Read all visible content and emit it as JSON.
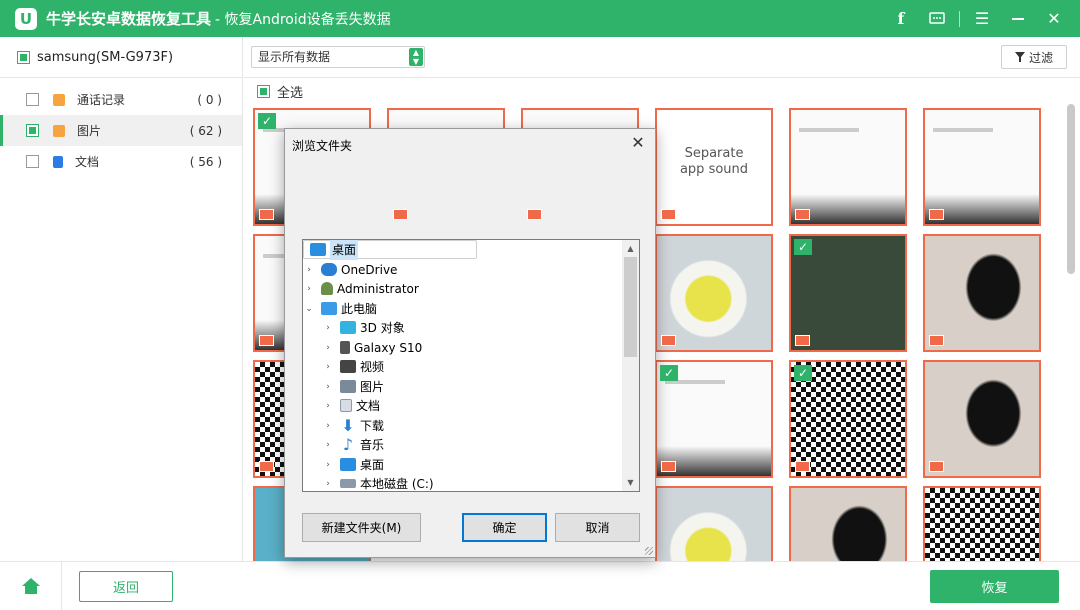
{
  "app": {
    "logo_letter": "U",
    "title": "牛学长安卓数据恢复工具",
    "subtitle": "- 恢复Android设备丢失数据",
    "icons": [
      "facebook-icon",
      "feedback-icon",
      "menu-icon",
      "minimize-icon",
      "close-icon"
    ],
    "accent_color": "#2fb36b",
    "marker_color": "#f06a4a"
  },
  "sidebar": {
    "device": "samsung(SM-G973F)",
    "items": [
      {
        "label": "通话记录",
        "count": "( 0 )",
        "icon": "phone-log-icon",
        "active": false
      },
      {
        "label": "图片",
        "count": "( 62 )",
        "icon": "image-icon",
        "active": true
      },
      {
        "label": "文档",
        "count": "( 56 )",
        "icon": "document-icon",
        "active": false
      }
    ]
  },
  "toolbar": {
    "view_select": "显示所有数据",
    "filter_label": "过滤",
    "select_all": "全选"
  },
  "grid": {
    "separate_sound_line1": "Separate",
    "separate_sound_line2": "app sound"
  },
  "bottom": {
    "back_label": "返回",
    "recover_label": "恢复"
  },
  "dialog": {
    "title": "浏览文件夹",
    "close": "✕",
    "tree": [
      {
        "label": "桌面",
        "level": 0,
        "expander": "",
        "selected": true
      },
      {
        "label": "OneDrive",
        "level": 0,
        "expander": "›",
        "selected": false
      },
      {
        "label": "Administrator",
        "level": 0,
        "expander": "›",
        "selected": false
      },
      {
        "label": "此电脑",
        "level": 0,
        "expander": "⌄",
        "selected": false
      },
      {
        "label": "3D 对象",
        "level": 1,
        "expander": "›",
        "selected": false
      },
      {
        "label": "Galaxy S10",
        "level": 1,
        "expander": "›",
        "selected": false
      },
      {
        "label": "视频",
        "level": 1,
        "expander": "›",
        "selected": false
      },
      {
        "label": "图片",
        "level": 1,
        "expander": "›",
        "selected": false
      },
      {
        "label": "文档",
        "level": 1,
        "expander": "›",
        "selected": false
      },
      {
        "label": "下载",
        "level": 1,
        "expander": "›",
        "selected": false
      },
      {
        "label": "音乐",
        "level": 1,
        "expander": "›",
        "selected": false
      },
      {
        "label": "桌面",
        "level": 1,
        "expander": "›",
        "selected": false
      },
      {
        "label": "本地磁盘 (C:)",
        "level": 1,
        "expander": "›",
        "selected": false
      }
    ],
    "new_folder_label": "新建文件夹(M)",
    "ok_label": "确定",
    "cancel_label": "取消"
  }
}
